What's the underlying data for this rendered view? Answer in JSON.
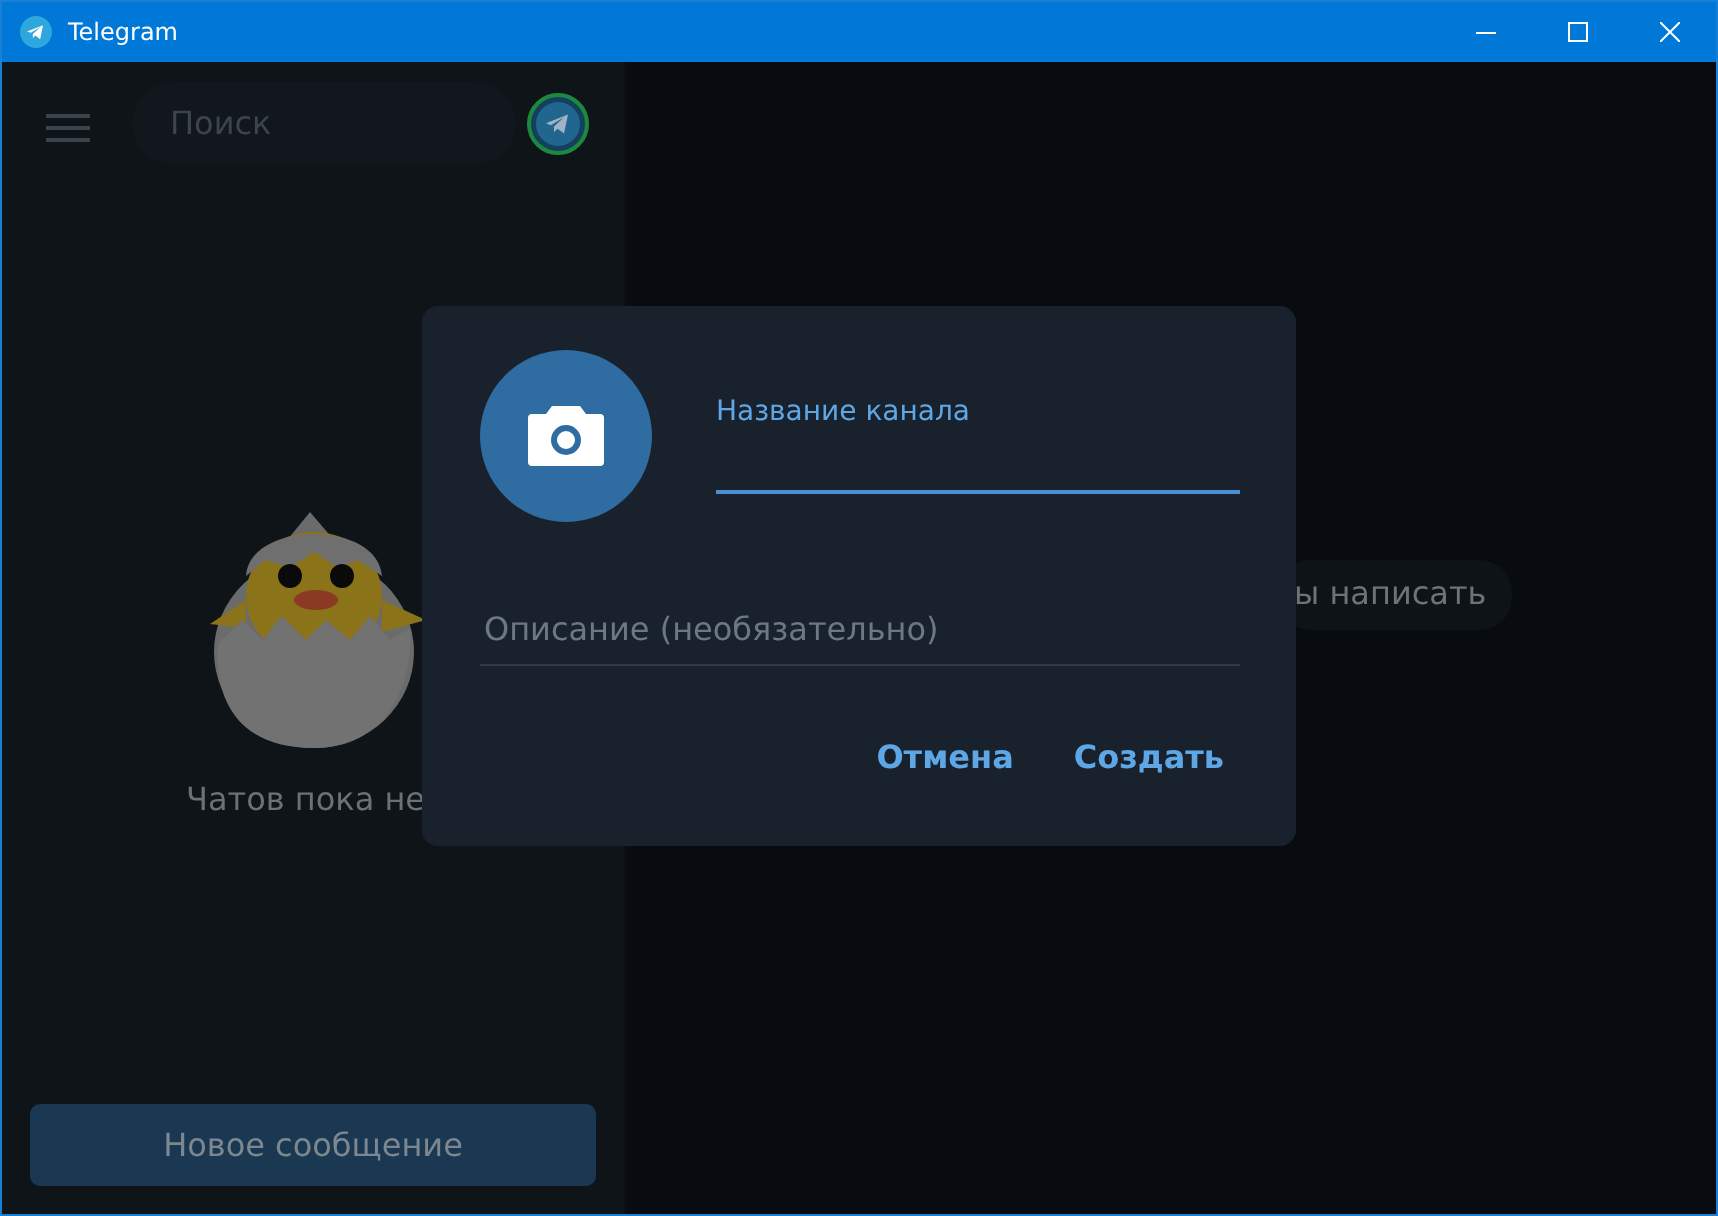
{
  "window": {
    "title": "Telegram"
  },
  "sidebar": {
    "search": {
      "placeholder": "Поиск"
    },
    "empty_text": "Чатов пока не",
    "new_message_button": "Новое сообщение"
  },
  "chat_area": {
    "hint": "ы написать"
  },
  "dialog": {
    "name_field": {
      "label": "Название канала",
      "focused": true
    },
    "description_field": {
      "placeholder": "Описание (необязательно)"
    },
    "buttons": [
      "Отмена",
      "Создать"
    ]
  }
}
